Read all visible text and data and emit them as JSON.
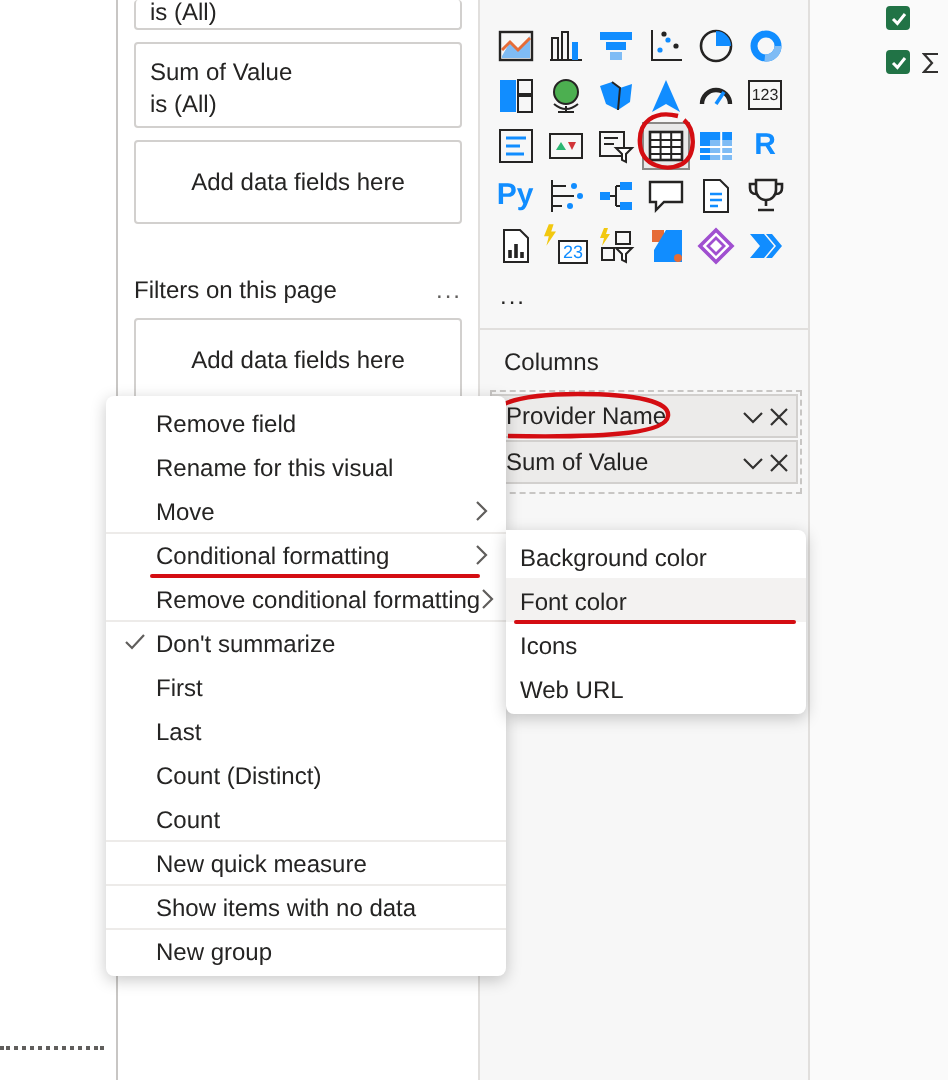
{
  "filter_pane": {
    "visual_filters": [
      {
        "kind": "filter",
        "lines": [
          "is (All)"
        ]
      },
      {
        "kind": "filter",
        "lines": [
          "Sum of Value",
          "is (All)"
        ]
      },
      {
        "kind": "drop",
        "label": "Add data fields here"
      }
    ],
    "page_section": {
      "title": "Filters on this page",
      "more": "...",
      "cards": [
        {
          "kind": "drop",
          "label": "Add data fields here"
        }
      ]
    }
  },
  "visualizations": {
    "icons": [
      {
        "kind": "area-map",
        "selected": false,
        "circled": false
      },
      {
        "kind": "column",
        "selected": false,
        "circled": false
      },
      {
        "kind": "funnel",
        "selected": false,
        "circled": false
      },
      {
        "kind": "scatter",
        "selected": false,
        "circled": false
      },
      {
        "kind": "pie",
        "selected": false,
        "circled": false
      },
      {
        "kind": "donut",
        "selected": false,
        "circled": false
      },
      {
        "kind": "treemap",
        "selected": false,
        "circled": false
      },
      {
        "kind": "globe",
        "selected": false,
        "circled": false
      },
      {
        "kind": "filled-map",
        "selected": false,
        "circled": false
      },
      {
        "kind": "triangle",
        "selected": false,
        "circled": false
      },
      {
        "kind": "gauge",
        "selected": false,
        "circled": false
      },
      {
        "kind": "text-card",
        "label": "123",
        "selected": false,
        "circled": false
      },
      {
        "kind": "multi-card",
        "selected": false,
        "circled": false
      },
      {
        "kind": "kpi",
        "selected": false,
        "circled": false
      },
      {
        "kind": "slicer",
        "selected": false,
        "circled": false
      },
      {
        "kind": "table",
        "selected": true,
        "circled": true
      },
      {
        "kind": "matrix",
        "selected": false,
        "circled": false
      },
      {
        "kind": "text",
        "label": "R",
        "selected": false,
        "circled": false
      },
      {
        "kind": "text",
        "label": "Py",
        "selected": false,
        "circled": false
      },
      {
        "kind": "influencers",
        "selected": false,
        "circled": false
      },
      {
        "kind": "tree",
        "selected": false,
        "circled": false
      },
      {
        "kind": "bubble",
        "selected": false,
        "circled": false
      },
      {
        "kind": "document",
        "selected": false,
        "circled": false
      },
      {
        "kind": "trophy",
        "selected": false,
        "circled": false
      },
      {
        "kind": "report",
        "selected": false,
        "circled": false
      },
      {
        "kind": "flash-card",
        "label": "23",
        "selected": false,
        "circled": false
      },
      {
        "kind": "flash-filter",
        "selected": false,
        "circled": false
      },
      {
        "kind": "flash-arrow",
        "selected": false,
        "circled": false
      },
      {
        "kind": "diamond",
        "selected": false,
        "circled": false
      },
      {
        "kind": "chevrons",
        "selected": false,
        "circled": false
      }
    ],
    "more": "...",
    "columns_label": "Columns",
    "wells": [
      {
        "label": "Provider Name",
        "circled": true
      },
      {
        "label": "Sum of Value",
        "circled": false
      }
    ]
  },
  "field_list": [
    {
      "checked": true,
      "sum": false
    },
    {
      "checked": true,
      "sum": true
    }
  ],
  "context_menu": {
    "items": [
      {
        "label": "Remove field",
        "submenu": false,
        "checked": false,
        "underlined": false,
        "divider_before": false
      },
      {
        "label": "Rename for this visual",
        "submenu": false,
        "checked": false,
        "underlined": false,
        "divider_before": false
      },
      {
        "label": "Move",
        "submenu": true,
        "checked": false,
        "underlined": false,
        "divider_before": false
      },
      {
        "label": "Conditional formatting",
        "submenu": true,
        "checked": false,
        "underlined": true,
        "divider_before": true
      },
      {
        "label": "Remove conditional formatting",
        "submenu": true,
        "checked": false,
        "underlined": false,
        "divider_before": false
      },
      {
        "label": "Don't summarize",
        "submenu": false,
        "checked": true,
        "underlined": false,
        "divider_before": true
      },
      {
        "label": "First",
        "submenu": false,
        "checked": false,
        "underlined": false,
        "divider_before": false
      },
      {
        "label": "Last",
        "submenu": false,
        "checked": false,
        "underlined": false,
        "divider_before": false
      },
      {
        "label": "Count (Distinct)",
        "submenu": false,
        "checked": false,
        "underlined": false,
        "divider_before": false
      },
      {
        "label": "Count",
        "submenu": false,
        "checked": false,
        "underlined": false,
        "divider_before": false
      },
      {
        "label": "New quick measure",
        "submenu": false,
        "checked": false,
        "underlined": false,
        "divider_before": true
      },
      {
        "label": "Show items with no data",
        "submenu": false,
        "checked": false,
        "underlined": false,
        "divider_before": true
      },
      {
        "label": "New group",
        "submenu": false,
        "checked": false,
        "underlined": false,
        "divider_before": true
      }
    ]
  },
  "submenu": {
    "items": [
      {
        "label": "Background color",
        "hovered": false,
        "underlined": false
      },
      {
        "label": "Font color",
        "hovered": true,
        "underlined": true
      },
      {
        "label": "Icons",
        "hovered": false,
        "underlined": false
      },
      {
        "label": "Web URL",
        "hovered": false,
        "underlined": false
      }
    ]
  }
}
